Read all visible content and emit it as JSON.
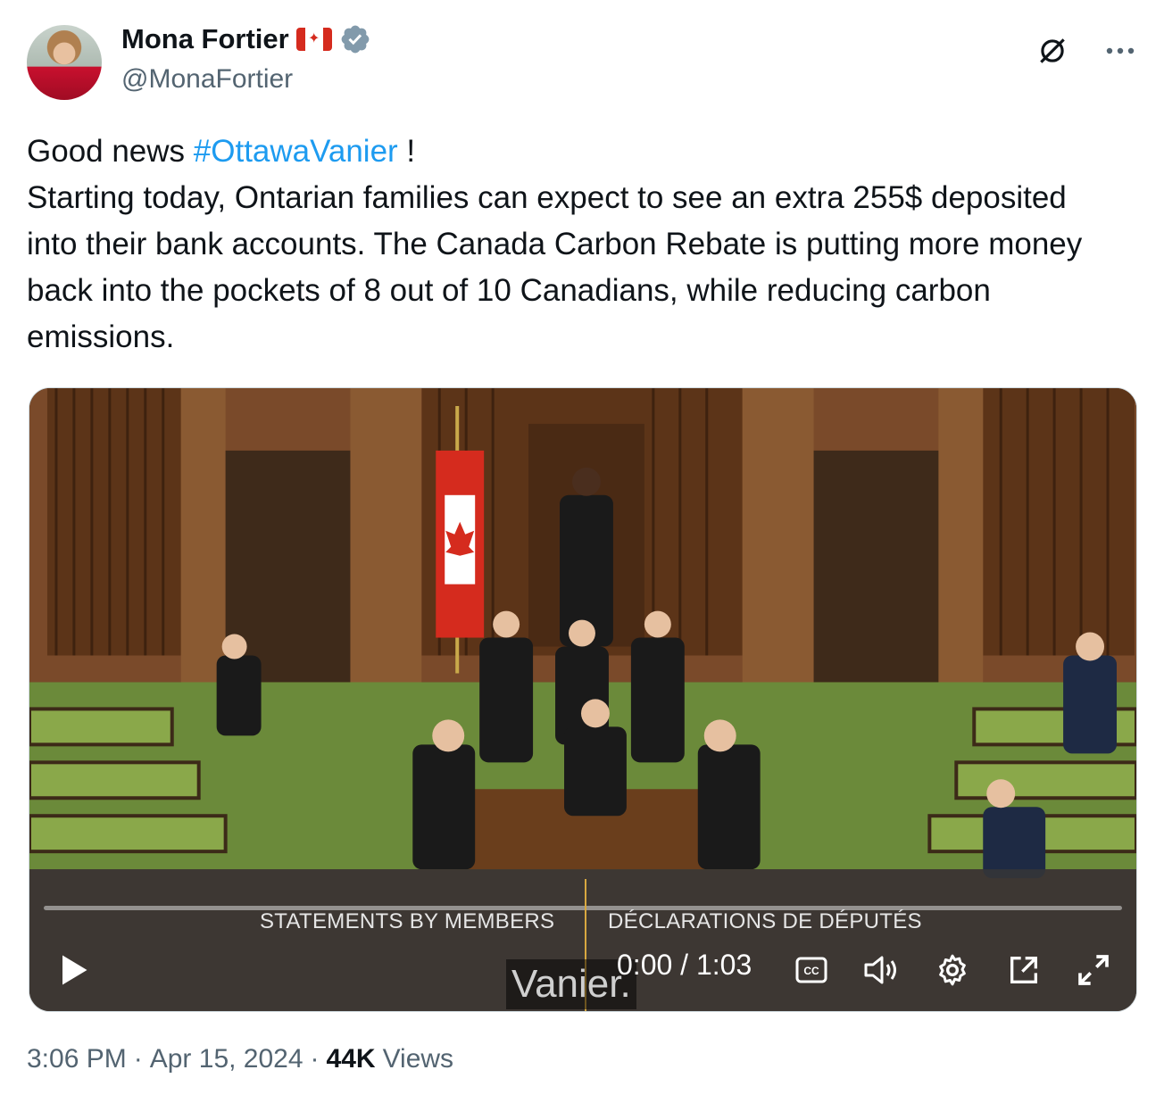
{
  "author": {
    "name": "Mona Fortier",
    "handle": "@MonaFortier",
    "flag_icon": "canada-flag-icon",
    "verified_icon": "verified-badge-icon"
  },
  "tweet": {
    "text_before_hashtag": "Good news ",
    "hashtag": "#OttawaVanier",
    "text_after_hashtag": " !\nStarting today, Ontarian families can expect to see an extra 255$ deposited into their bank accounts. The Canada Carbon Rebate is putting more money back into the pockets of 8 out of 10 Canadians, while reducing carbon emissions."
  },
  "video": {
    "caption_en": "STATEMENTS BY MEMBERS",
    "caption_fr": "DÉCLARATIONS DE DÉPUTÉS",
    "subtitle": "Vanier.",
    "time": "0:00 / 1:03",
    "cc_label": "CC"
  },
  "meta": {
    "time": "3:06 PM",
    "sep1": "·",
    "date": "Apr 15, 2024",
    "sep2": "·",
    "views_count": "44K",
    "views_label": "Views"
  },
  "colors": {
    "hashtag": "#1d9bf0",
    "verified": "#829aab",
    "secondary_text": "#536471"
  }
}
